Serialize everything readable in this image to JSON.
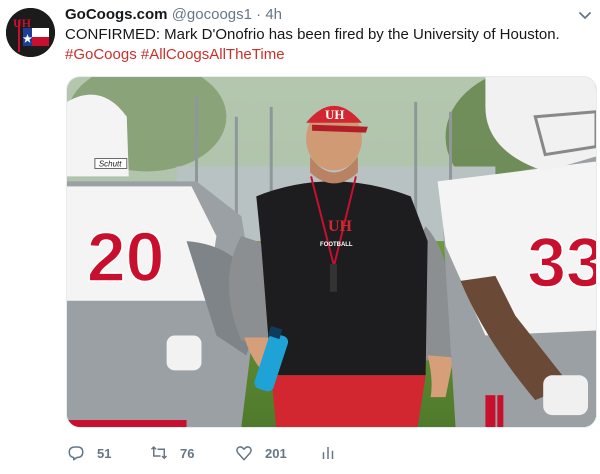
{
  "tweet": {
    "display_name": "GoCoogs.com",
    "handle": "@gocoogs1",
    "separator": "·",
    "timestamp": "4h",
    "text": "CONFIRMED: Mark D'Onofrio has been fired by the University of Houston.",
    "hashtags": [
      "#GoCoogs",
      "#AllCoogsAllTheTime"
    ],
    "media_text": {
      "jersey_left": "20",
      "jersey_right": "33",
      "sleeve_text": "Schutt",
      "cap_logo": "UH",
      "shirt_logo": "UH",
      "shirt_label": "FOOTBALL"
    }
  },
  "actions": {
    "reply_count": "51",
    "retweet_count": "76",
    "like_count": "201"
  },
  "icons": {
    "reply": "reply-icon",
    "retweet": "retweet-icon",
    "like": "heart-icon",
    "analytics": "analytics-icon",
    "menu": "chevron-down-icon"
  },
  "colors": {
    "hashtag": "#c9302c",
    "muted": "#657786",
    "text": "#14171a"
  }
}
